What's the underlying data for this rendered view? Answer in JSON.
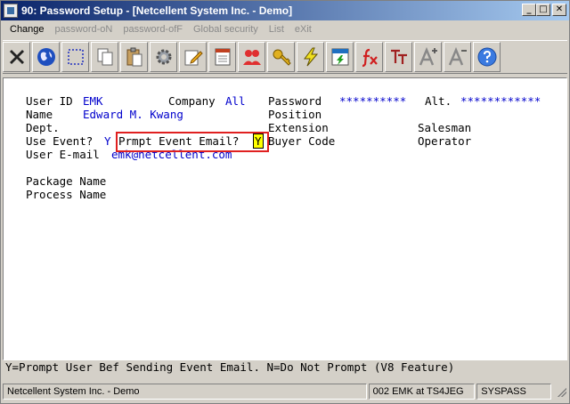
{
  "window": {
    "title": "90: Password Setup - [Netcellent System Inc. - Demo]",
    "minimize": "_",
    "maximize": "□",
    "close": "✕"
  },
  "menu": [
    {
      "label": "Change",
      "enabled": true
    },
    {
      "label": "password-oN",
      "enabled": false
    },
    {
      "label": "password-ofF",
      "enabled": false
    },
    {
      "label": "Global security",
      "enabled": false
    },
    {
      "label": "List",
      "enabled": false
    },
    {
      "label": "eXit",
      "enabled": false
    }
  ],
  "toolbar": [
    "close-x-icon",
    "globe-icon",
    "select-box-icon",
    "copy-icon",
    "paste-icon",
    "gear-icon",
    "edit-pencil-icon",
    "notepad-icon",
    "users-icon",
    "key-icon",
    "lightning-icon",
    "calendar-run-icon",
    "fx-function-icon",
    "font-tt-icon",
    "font-increase-icon",
    "font-decrease-icon",
    "help-icon"
  ],
  "form": {
    "user_id_label": "User ID",
    "user_id": "EMK",
    "company_label": "Company",
    "company": "All",
    "password_label": "Password",
    "password": "**********",
    "alt_label": "Alt.",
    "alt": "************",
    "name_label": "Name",
    "name": "Edward M. Kwang",
    "position_label": "Position",
    "dept_label": "Dept.",
    "extension_label": "Extension",
    "salesman_label": "Salesman",
    "use_event_label": "Use Event?",
    "use_event": "Y",
    "prompt_label": "Prmpt Event Email?",
    "prompt_value": "Y",
    "buyer_code_label": "Buyer Code",
    "operator_label": "Operator",
    "email_label": "User E-mail",
    "email": "emk@netcellent.com",
    "package_label": "Package Name",
    "process_label": "Process Name"
  },
  "hint": "Y=Prompt User Bef Sending Event Email. N=Do Not Prompt (V8 Feature)",
  "status": {
    "company": "Netcellent System Inc. - Demo",
    "session": "002 EMK at TS4JEG",
    "program": "SYSPASS"
  }
}
